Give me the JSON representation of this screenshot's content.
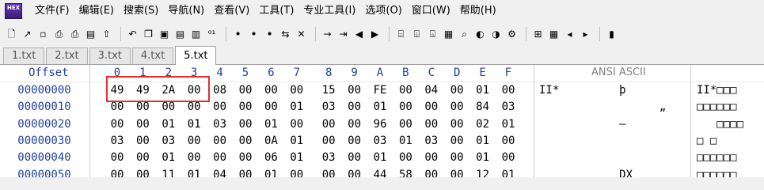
{
  "app": {
    "logo_text": "HEX"
  },
  "menu": [
    "文件(F)",
    "编辑(E)",
    "搜索(S)",
    "导航(N)",
    "查看(V)",
    "工具(T)",
    "专业工具(I)",
    "选项(O)",
    "窗口(W)",
    "帮助(H)"
  ],
  "toolbar_icons": [
    "new-file-icon",
    "open-file-icon",
    "save-icon",
    "print-icon",
    "print-preview-icon",
    "properties-icon",
    "export-icon",
    "sep",
    "undo-icon",
    "copy-icon",
    "cut-copy-icon",
    "paste-icon",
    "paste-special-icon",
    "binary-icon",
    "sep",
    "find-icon",
    "find-replace-icon",
    "find-hex-icon",
    "goto-icon",
    "replace-hex-icon",
    "sep",
    "goto-offset-icon",
    "bookmark-icon",
    "back-icon",
    "forward-icon",
    "sep",
    "disk-icon",
    "ram-icon",
    "drive-icon",
    "calculator-icon",
    "search-disk-icon",
    "tool1-icon",
    "tool2-icon",
    "gear-icon",
    "sep",
    "layout-icon",
    "table-icon",
    "prev-icon",
    "next-icon",
    "sep",
    "book-icon"
  ],
  "toolbar_glyphs": {
    "new-file-icon": "🗋",
    "open-file-icon": "↗",
    "save-icon": "▫",
    "print-icon": "⎙",
    "print-preview-icon": "⎙",
    "properties-icon": "▤",
    "export-icon": "⇧",
    "undo-icon": "↶",
    "copy-icon": "❐",
    "cut-copy-icon": "▣",
    "paste-icon": "▤",
    "paste-special-icon": "▥",
    "binary-icon": "⁰¹",
    "find-icon": "ꔷ",
    "find-replace-icon": "ꔷ",
    "find-hex-icon": "ꔷ",
    "goto-icon": "⇆",
    "replace-hex-icon": "✕",
    "goto-offset-icon": "→",
    "bookmark-icon": "⇥",
    "back-icon": "◀",
    "forward-icon": "▶",
    "disk-icon": "⌸",
    "ram-icon": "⌹",
    "drive-icon": "⌺",
    "calculator-icon": "▦",
    "search-disk-icon": "⌕",
    "tool1-icon": "◐",
    "tool2-icon": "◑",
    "gear-icon": "⚙",
    "layout-icon": "⊞",
    "table-icon": "▦",
    "prev-icon": "◂",
    "next-icon": "▸",
    "book-icon": "▮"
  },
  "tabs": [
    {
      "label": "1.txt",
      "active": false
    },
    {
      "label": "2.txt",
      "active": false
    },
    {
      "label": "3.txt",
      "active": false
    },
    {
      "label": "4.txt",
      "active": false
    },
    {
      "label": "5.txt",
      "active": true
    }
  ],
  "hex": {
    "offset_header": "Offset",
    "columns": [
      "0",
      "1",
      "2",
      "3",
      "4",
      "5",
      "6",
      "7",
      "8",
      "9",
      "A",
      "B",
      "C",
      "D",
      "E",
      "F"
    ],
    "ascii_header": "ANSI ASCII",
    "rows": [
      {
        "offset": "00000000",
        "bytes": [
          "49",
          "49",
          "2A",
          "00",
          "08",
          "00",
          "00",
          "00",
          "15",
          "00",
          "FE",
          "00",
          "04",
          "00",
          "01",
          "00"
        ],
        "ansi": "II*         þ",
        "ascii": "II*□□□"
      },
      {
        "offset": "00000010",
        "bytes": [
          "00",
          "00",
          "00",
          "00",
          "00",
          "00",
          "00",
          "01",
          "03",
          "00",
          "01",
          "00",
          "00",
          "00",
          "84",
          "03"
        ],
        "ansi": "                  „",
        "ascii": "□□□□□□"
      },
      {
        "offset": "00000020",
        "bytes": [
          "00",
          "00",
          "01",
          "01",
          "03",
          "00",
          "01",
          "00",
          "00",
          "00",
          "96",
          "00",
          "00",
          "00",
          "02",
          "01"
        ],
        "ansi": "            –",
        "ascii": "   □□□□"
      },
      {
        "offset": "00000030",
        "bytes": [
          "03",
          "00",
          "03",
          "00",
          "00",
          "00",
          "0A",
          "01",
          "00",
          "00",
          "03",
          "01",
          "03",
          "00",
          "01",
          "00"
        ],
        "ansi": "",
        "ascii": "□ □"
      },
      {
        "offset": "00000040",
        "bytes": [
          "00",
          "00",
          "01",
          "00",
          "00",
          "00",
          "06",
          "01",
          "03",
          "00",
          "01",
          "00",
          "00",
          "00",
          "01",
          "00"
        ],
        "ansi": "",
        "ascii": "□□□□□□"
      },
      {
        "offset": "00000050",
        "bytes": [
          "00",
          "00",
          "11",
          "01",
          "04",
          "00",
          "01",
          "00",
          "00",
          "00",
          "44",
          "58",
          "00",
          "00",
          "12",
          "01"
        ],
        "ansi": "            DX",
        "ascii": "□□□□□□"
      }
    ]
  },
  "highlight": {
    "label": "selected-bytes",
    "color": "#e03030"
  }
}
